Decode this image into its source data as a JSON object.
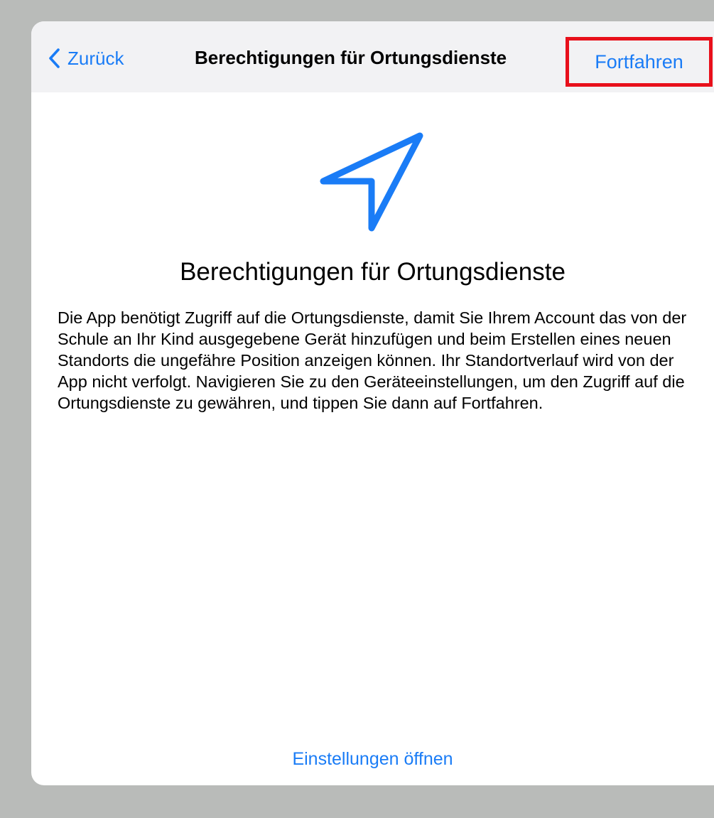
{
  "colors": {
    "accent": "#1a7cf6",
    "highlight_border": "#e8101b",
    "backdrop": "#b9bbb9",
    "navbar_bg": "#f2f2f4"
  },
  "navbar": {
    "back_label": "Zurück",
    "back_icon": "chevron-left-icon",
    "title": "Berechtigungen für Ortungsdienste",
    "continue_label": "Fortfahren"
  },
  "main": {
    "icon": "location-arrow-icon",
    "heading": "Berechtigungen für Ortungsdienste",
    "description": "Die App benötigt Zugriff auf die Ortungsdienste, damit Sie Ihrem Account das von der Schule an Ihr Kind ausgegebene Gerät hinzufügen und beim Erstellen eines neuen Standorts die ungefähre Position anzeigen können. Ihr Standortverlauf wird von der App nicht verfolgt. Navigieren Sie zu den Geräteeinstellungen, um den Zugriff auf die Ortungsdienste zu gewähren, und tippen Sie dann auf Fortfahren.",
    "open_settings_label": "Einstellungen öffnen"
  }
}
